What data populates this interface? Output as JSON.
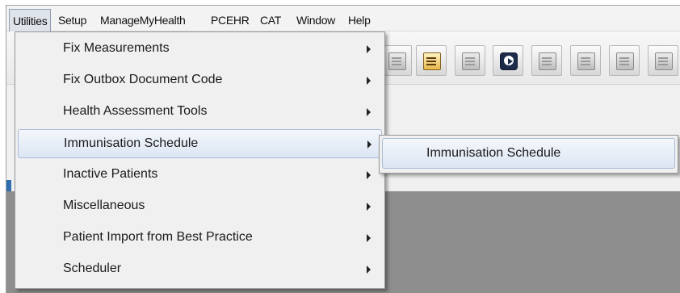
{
  "menubar": {
    "items": [
      "Utilities",
      "Setup",
      "ManageMyHealth",
      "PCEHR",
      "CAT",
      "Window",
      "Help"
    ]
  },
  "utilities_menu": {
    "items": [
      {
        "label": "Fix Measurements",
        "has_submenu": true
      },
      {
        "label": "Fix Outbox Document Code",
        "has_submenu": true
      },
      {
        "label": "Health Assessment Tools",
        "has_submenu": true
      },
      {
        "label": "Immunisation Schedule",
        "has_submenu": true,
        "highlighted": true
      },
      {
        "label": "Inactive Patients",
        "has_submenu": true
      },
      {
        "label": "Miscellaneous",
        "has_submenu": true
      },
      {
        "label": "Patient Import from Best Practice",
        "has_submenu": true
      },
      {
        "label": "Scheduler",
        "has_submenu": true
      }
    ]
  },
  "submenu": {
    "items": [
      {
        "label": "Immunisation Schedule",
        "highlighted": true
      }
    ]
  },
  "toolbar": {
    "buttons": [
      "toolbar-button",
      "calculator-icon",
      "calendar-icon",
      "play-icon",
      "calendar-icon",
      "calendar-icon",
      "edit-icon",
      "toolbar-button"
    ]
  },
  "colors": {
    "menu_background": "#f0f0f0",
    "highlight": "#dce6f4",
    "highlight_border": "#a8bbd6",
    "workspace": "#8e8e8e"
  }
}
